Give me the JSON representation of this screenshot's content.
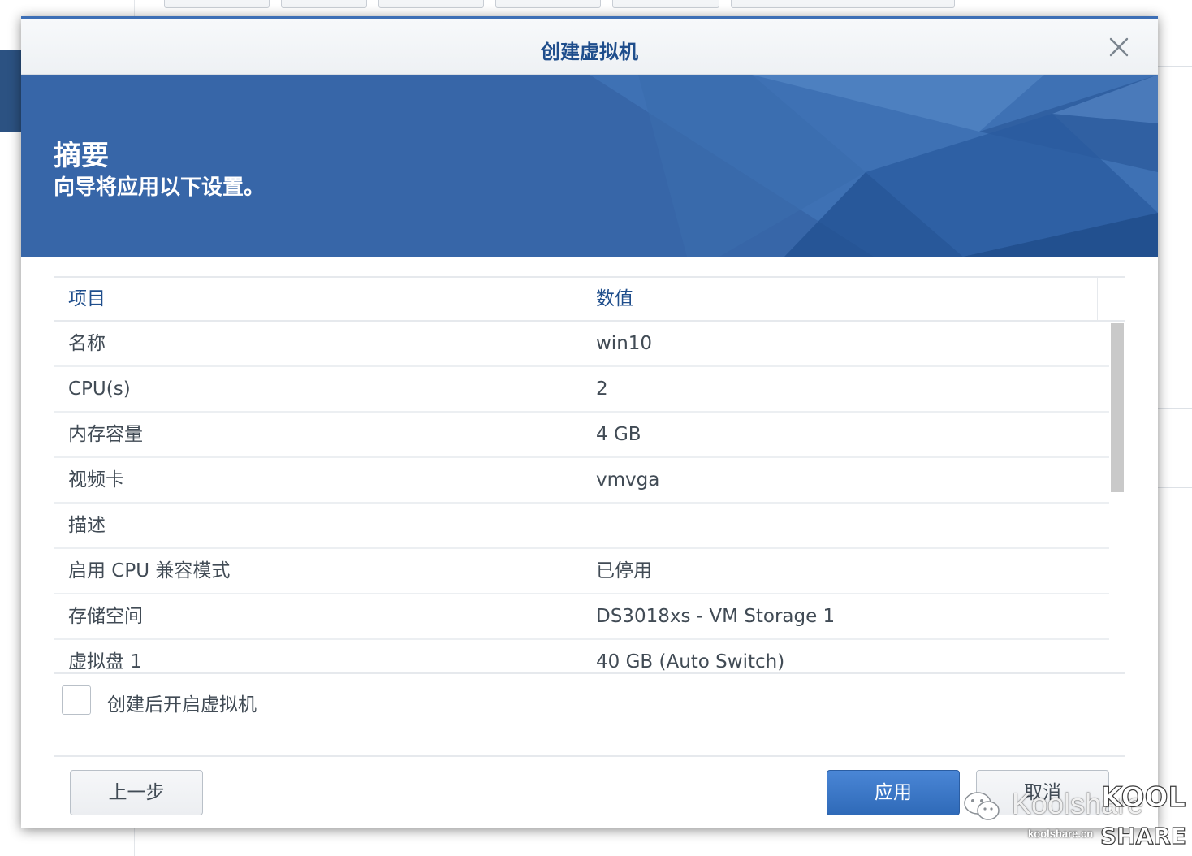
{
  "dialog": {
    "title": "创建虚拟机",
    "close_icon": "close-icon"
  },
  "banner": {
    "title": "摘要",
    "subtitle": "向导将应用以下设置。"
  },
  "grid": {
    "columns": [
      "项目",
      "数值"
    ],
    "rows": [
      {
        "item": "名称",
        "value": "win10"
      },
      {
        "item": "CPU(s)",
        "value": "2"
      },
      {
        "item": "内存容量",
        "value": "4 GB"
      },
      {
        "item": "视频卡",
        "value": "vmvga"
      },
      {
        "item": "描述",
        "value": ""
      },
      {
        "item": "启用 CPU 兼容模式",
        "value": "已停用"
      },
      {
        "item": "存储空间",
        "value": "DS3018xs - VM Storage 1"
      },
      {
        "item": "虚拟盘 1",
        "value": "40 GB (Auto Switch)"
      }
    ]
  },
  "autostart": {
    "label": "创建后开启虚拟机",
    "checked": false
  },
  "footer": {
    "back_label": "上一步",
    "apply_label": "应用",
    "cancel_label": "取消"
  },
  "watermark": {
    "text": "Koolshare",
    "sub": "koolshare.cn",
    "logo_top": "KOOL",
    "logo_bottom": "SHARE",
    "icon": "wechat-icon"
  },
  "colors": {
    "accent": "#3d6fb6",
    "title": "#1f4e8c",
    "banner": "#3766a8",
    "primary_button": "#3a76c8"
  }
}
